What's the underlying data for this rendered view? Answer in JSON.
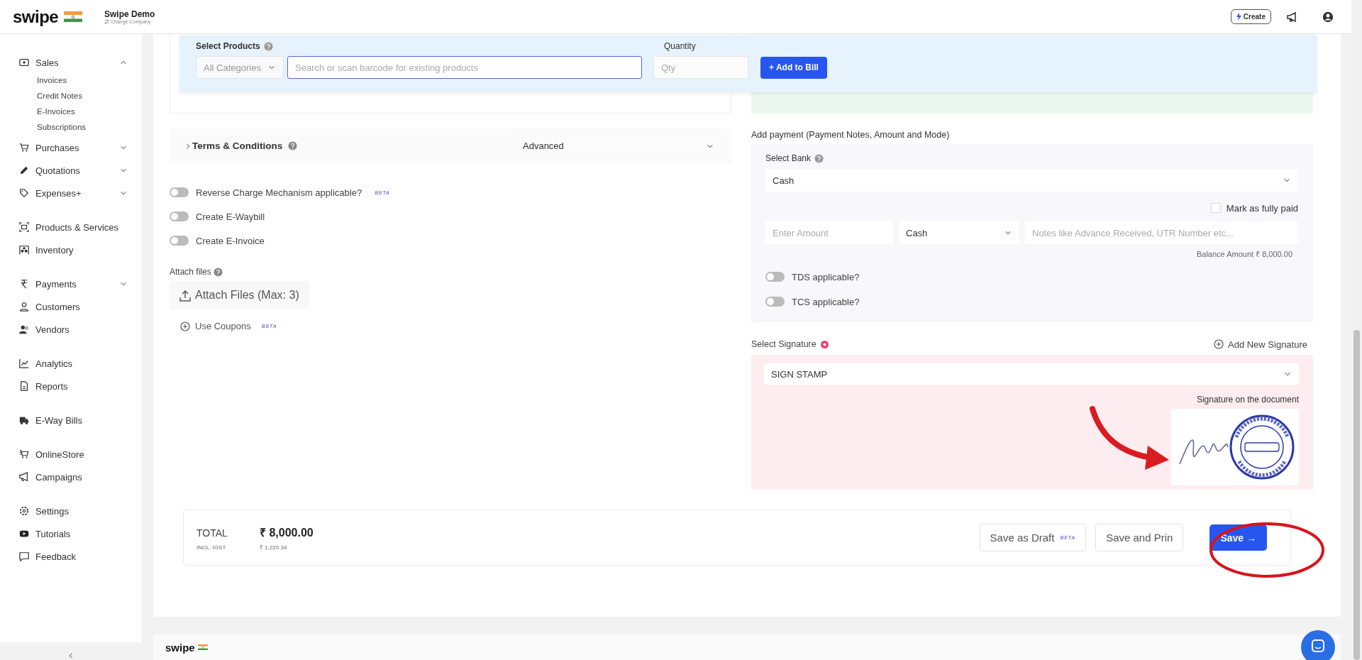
{
  "header": {
    "logo": "swipe",
    "company": "Swipe Demo",
    "company_sub": "Change Company",
    "create_button": "Create"
  },
  "sidebar": {
    "groups": [
      [
        {
          "label": "Sales",
          "expanded": true,
          "children": [
            "Invoices",
            "Credit Notes",
            "E-Invoices",
            "Subscriptions"
          ]
        },
        {
          "label": "Purchases",
          "expanded": false
        },
        {
          "label": "Quotations",
          "expanded": false
        },
        {
          "label": "Expenses+",
          "expanded": false
        }
      ],
      [
        {
          "label": "Products & Services"
        },
        {
          "label": "Inventory"
        }
      ],
      [
        {
          "label": "Payments",
          "expanded": false
        },
        {
          "label": "Customers"
        },
        {
          "label": "Vendors"
        }
      ],
      [
        {
          "label": "Analytics"
        },
        {
          "label": "Reports"
        }
      ],
      [
        {
          "label": "E-Way Bills"
        }
      ],
      [
        {
          "label": "OnlineStore"
        },
        {
          "label": "Campaigns"
        }
      ],
      [
        {
          "label": "Settings"
        },
        {
          "label": "Tutorials"
        },
        {
          "label": "Feedback"
        }
      ]
    ]
  },
  "product_bar": {
    "label": "Select Products",
    "category": "All Categories",
    "search_placeholder": "Search or scan barcode for existing products",
    "quantity_label": "Quantity",
    "quantity_placeholder": "Qty",
    "add_button": "+ Add to Bill"
  },
  "terms": {
    "label": "Terms & Conditions",
    "expanded": false,
    "select": "Advanced"
  },
  "toggles": [
    {
      "label": "Reverse Charge Mechanism applicable?",
      "badge": "BETA",
      "on": false
    },
    {
      "label": "Create E-Waybill",
      "on": false
    },
    {
      "label": "Create E-Invoice",
      "on": false
    }
  ],
  "attach": {
    "label": "Attach files",
    "button": "Attach Files (Max: 3)"
  },
  "coupons": {
    "label": "Use Coupons",
    "badge": "BETA"
  },
  "payment": {
    "title": "Add payment (Payment Notes, Amount and Mode)",
    "bank_label": "Select Bank",
    "bank": "Cash",
    "fully_paid": {
      "label": "Mark as fully paid",
      "checked": false
    },
    "amount_placeholder": "Enter Amount",
    "mode": "Cash",
    "notes_placeholder": "Notes like Advance Received, UTR Number etc...",
    "balance": "Balance Amount ₹ 8,000.00",
    "toggles": [
      {
        "label": "TDS applicable?",
        "on": false
      },
      {
        "label": "TCS applicable?",
        "on": false
      }
    ]
  },
  "signature": {
    "label": "Select Signature",
    "add_link": "Add New Signature",
    "select": "SIGN STAMP",
    "preview_label": "Signature on the document"
  },
  "total": {
    "label": "TOTAL",
    "amount": "₹ 8,000.00",
    "tax_label": "INCL. IGST",
    "tax": "₹ 1,220.34",
    "buttons": [
      {
        "label": "Save as Draft",
        "badge": "BETA",
        "kind": "outline"
      },
      {
        "label": "Save and Prin",
        "kind": "outline"
      },
      {
        "label": "Save →",
        "kind": "primary"
      }
    ]
  },
  "footer": {
    "logo": "swipe"
  }
}
